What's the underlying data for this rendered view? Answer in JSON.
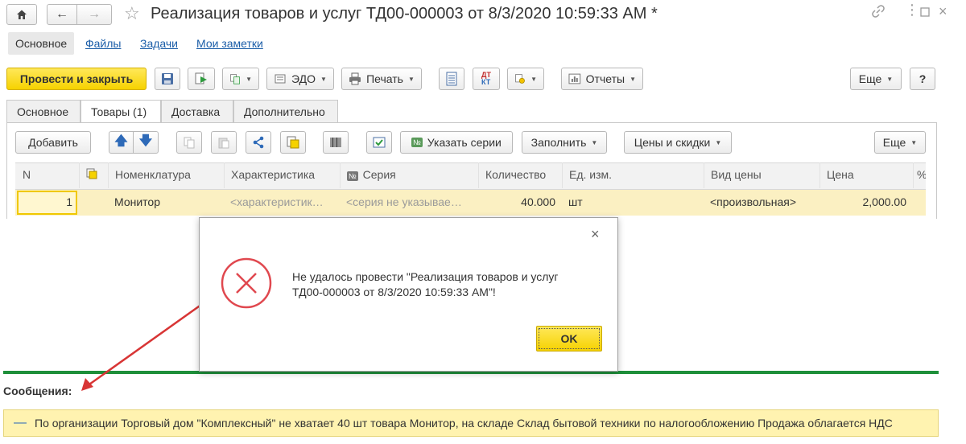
{
  "window": {
    "title": "Реализация товаров и услуг ТД00-000003 от 8/3/2020 10:59:33 AM *"
  },
  "nav": {
    "links": [
      "Основное",
      "Файлы",
      "Задачи",
      "Мои заметки"
    ]
  },
  "toolbar": {
    "post_close": "Провести и закрыть",
    "edo": "ЭДО",
    "print": "Печать",
    "reports": "Отчеты",
    "more": "Еще",
    "help": "?"
  },
  "tabs": [
    "Основное",
    "Товары (1)",
    "Доставка",
    "Дополнительно"
  ],
  "goods_toolbar": {
    "add": "Добавить",
    "series": "Указать серии",
    "fill": "Заполнить",
    "prices": "Цены и скидки",
    "more": "Еще"
  },
  "table": {
    "headers": [
      "N",
      "Номенклатура",
      "Характеристика",
      "Серия",
      "Количество",
      "Ед. изм.",
      "Вид цены",
      "Цена",
      "%"
    ],
    "row": {
      "n": "1",
      "item": "Монитор",
      "characteristic": "<характеристик…",
      "series": "<серия не указывае…",
      "quantity": "40.000",
      "unit": "шт",
      "price_type": "<произвольная>",
      "price": "2,000.00"
    }
  },
  "dialog": {
    "message_line1": "Не удалось провести \"Реализация товаров и услуг",
    "message_line2": "ТД00-000003 от 8/3/2020 10:59:33 AM\"!",
    "ok": "OK"
  },
  "messages": {
    "title": "Сообщения:",
    "text": "По организации Торговый дом \"Комплексный\" не хватает 40 шт товара Монитор, на складе Склад бытовой техники  по налогообложению Продажа облагается НДС"
  },
  "colors": {
    "accent_yellow": "#f6d200",
    "link_blue": "#1c5ea8",
    "error_red": "#e0484f",
    "separator_green": "#1e8f3a",
    "message_bg": "#fff3b0"
  }
}
